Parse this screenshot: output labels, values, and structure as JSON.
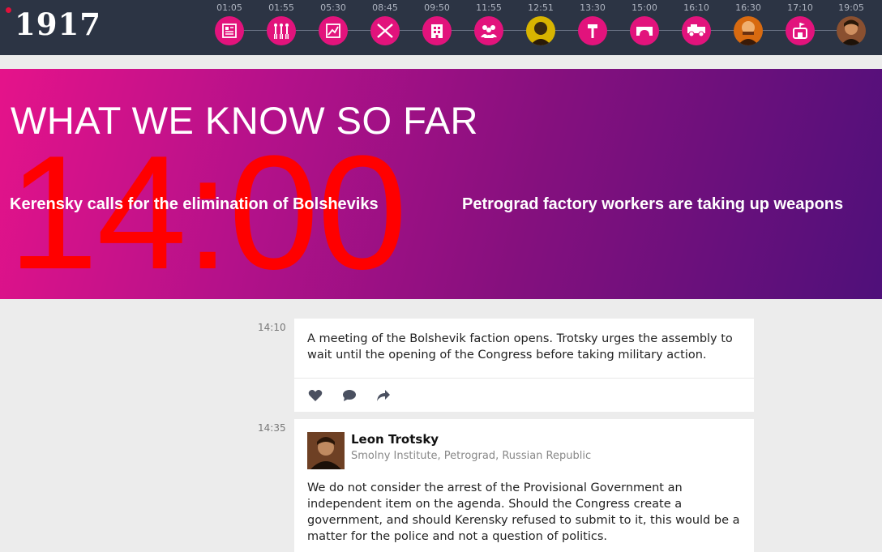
{
  "header": {
    "logo": "1917",
    "timeline": [
      {
        "time": "01:05",
        "icon": "newspaper-icon"
      },
      {
        "time": "01:55",
        "icon": "soldiers-icon"
      },
      {
        "time": "05:30",
        "icon": "map-icon"
      },
      {
        "time": "08:45",
        "icon": "crossed-rifles-icon"
      },
      {
        "time": "09:50",
        "icon": "building-icon"
      },
      {
        "time": "11:55",
        "icon": "crowd-icon"
      },
      {
        "time": "12:51",
        "icon": "portrait-icon"
      },
      {
        "time": "13:30",
        "icon": "hammer-icon"
      },
      {
        "time": "15:00",
        "icon": "bridge-icon"
      },
      {
        "time": "16:10",
        "icon": "armored-car-icon"
      },
      {
        "time": "16:30",
        "icon": "portrait-icon"
      },
      {
        "time": "17:10",
        "icon": "castle-flag-icon"
      },
      {
        "time": "19:05",
        "icon": "portrait-icon"
      }
    ]
  },
  "hero": {
    "title": "WHAT WE KNOW SO FAR",
    "big_time": "14:00",
    "headline_left": "Kerensky calls for the elimination of Bolsheviks",
    "headline_right": "Petrograd factory workers are taking up weapons"
  },
  "feed": {
    "entries": [
      {
        "time": "14:10",
        "text": "A meeting of the Bolshevik faction opens. Trotsky urges the assembly to wait until the opening of the Congress before taking military action.",
        "actions": [
          "heart-icon",
          "comment-icon",
          "share-icon"
        ]
      },
      {
        "time": "14:35",
        "author": "Leon Trotsky",
        "location": "Smolny Institute, Petrograd, Russian Republic",
        "text": "We do not consider the arrest of the Provisional Government an independent item on the agenda. Should the Congress create a government, and should Kerensky refused to submit to it, this would be a matter for the police and not a question of politics."
      }
    ]
  },
  "colors": {
    "topbar": "#2c3444",
    "accent": "#e2137c",
    "big_time": "#ff0000",
    "gradient_start": "#e5138a",
    "gradient_end": "#4f107a"
  }
}
